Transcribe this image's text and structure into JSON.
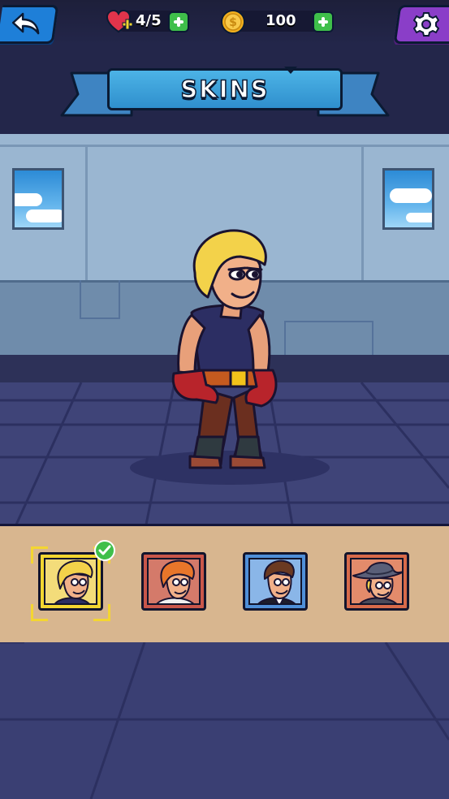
{
  "header": {
    "lives": "4/5",
    "coins": "100",
    "title": "SKINS"
  },
  "icons": {
    "back": "back-arrow-icon",
    "lives": "heart-plus-icon",
    "coins": "coin-icon",
    "add": "plus-icon",
    "settings": "gear-icon",
    "selected": "check-icon"
  },
  "skins": [
    {
      "id": "blonde-hero",
      "selected": true,
      "bg": "#f3dc7a"
    },
    {
      "id": "orange-hair-scientist",
      "selected": false,
      "bg": "#d47a6a"
    },
    {
      "id": "brown-hair-suit",
      "selected": false,
      "bg": "#8ab6e8"
    },
    {
      "id": "detective-hat",
      "selected": false,
      "bg": "#e38b6b"
    }
  ],
  "colors": {
    "accent_blue": "#2f8fcd",
    "settings_purple": "#8a3ec8",
    "plus_green": "#3fbf4a",
    "selection_yellow": "#f4d630",
    "tray": "#d8b68f"
  }
}
